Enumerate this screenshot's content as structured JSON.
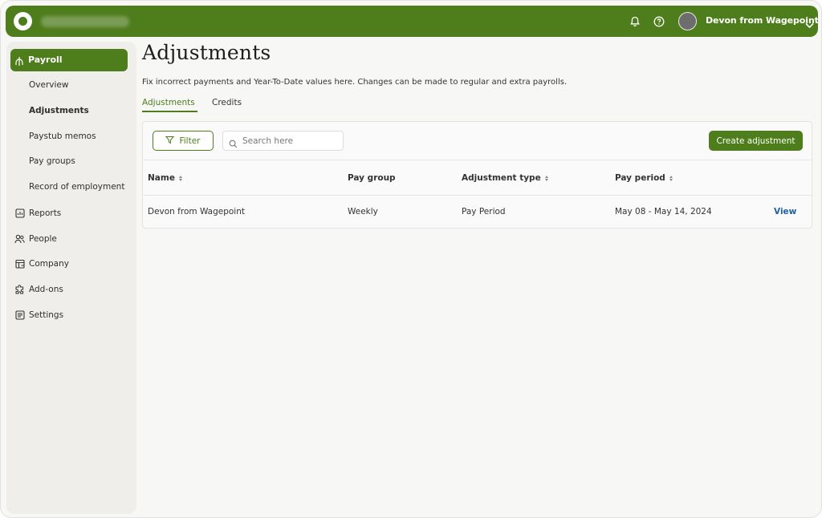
{
  "user": {
    "name": "Devon from Wagepoint"
  },
  "sidebar": {
    "payroll_label": "Payroll",
    "sub_items": [
      {
        "label": "Overview"
      },
      {
        "label": "Adjustments"
      },
      {
        "label": "Paystub memos"
      },
      {
        "label": "Pay groups"
      },
      {
        "label": "Record of employment"
      }
    ],
    "items": [
      {
        "label": "Reports",
        "icon": "reports-icon"
      },
      {
        "label": "People",
        "icon": "people-icon"
      },
      {
        "label": "Company",
        "icon": "company-icon"
      },
      {
        "label": "Add-ons",
        "icon": "puzzle-icon"
      },
      {
        "label": "Settings",
        "icon": "settings-icon"
      }
    ]
  },
  "page": {
    "title": "Adjustments",
    "description": "Fix incorrect payments and Year-To-Date values here. Changes can be made to regular and extra payrolls.",
    "tabs": [
      {
        "label": "Adjustments",
        "active": true
      },
      {
        "label": "Credits",
        "active": false
      }
    ]
  },
  "toolbar": {
    "filter_label": "Filter",
    "search_placeholder": "Search here",
    "create_label": "Create adjustment"
  },
  "table": {
    "headers": [
      "Name",
      "Pay group",
      "Adjustment type",
      "Pay period"
    ],
    "rows": [
      {
        "name": "Devon from Wagepoint",
        "pay_group": "Weekly",
        "adjustment_type": "Pay Period",
        "pay_period": "May 08 - May 14, 2024",
        "action": "View"
      }
    ]
  },
  "colors": {
    "brand": "#4e7d1b",
    "link": "#1f5fa8",
    "sidebar_bg": "#efeeea"
  }
}
